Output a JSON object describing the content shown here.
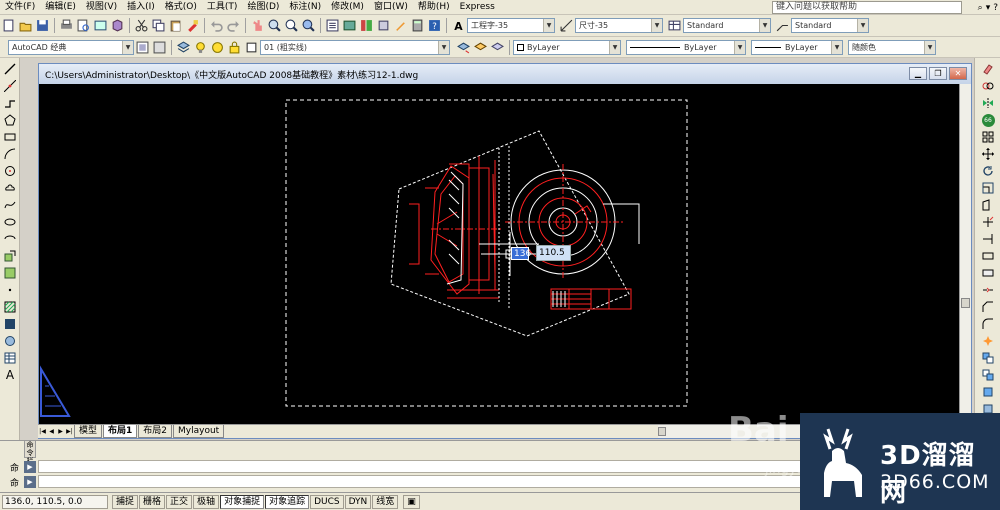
{
  "menu": [
    "文件(F)",
    "编辑(E)",
    "视图(V)",
    "插入(I)",
    "格式(O)",
    "工具(T)",
    "绘图(D)",
    "标注(N)",
    "修改(M)",
    "窗口(W)",
    "帮助(H)",
    "Express"
  ],
  "help_search_placeholder": "键入问题以获取帮助",
  "toolbar": {
    "text_style": "工程字-35",
    "dim_style": "尺寸-35",
    "table_style": "Standard",
    "multileader_style": "Standard",
    "workspace": "AutoCAD 经典",
    "layer": "01 (粗实线)",
    "color": "ByLayer",
    "linetype": "ByLayer",
    "lineweight": "ByLayer",
    "plotstyle": "随颜色"
  },
  "document": {
    "title": "C:\\Users\\Administrator\\Desktop\\《中文版AutoCAD 2008基础教程》素材\\练习12-1.dwg"
  },
  "dynamic_input": {
    "x": "136",
    "y": "110.5"
  },
  "layout_tabs": [
    "模型",
    "布局1",
    "布局2",
    "Mylayout"
  ],
  "command": {
    "label1": "命",
    "label2": "命",
    "side_tab": "命令栏"
  },
  "status": {
    "coords": "136.0, 110.5, 0.0",
    "buttons": [
      "捕捉",
      "栅格",
      "正交",
      "极轴",
      "对象捕捉",
      "对象追踪",
      "DUCS",
      "DYN",
      "线宽"
    ]
  },
  "watermark": {
    "brand": "3D溜溜网",
    "url": "3D66.COM"
  },
  "colors": {
    "canvas": "#000000",
    "drawing_red": "#ff2020",
    "drawing_white": "#ffffff"
  }
}
